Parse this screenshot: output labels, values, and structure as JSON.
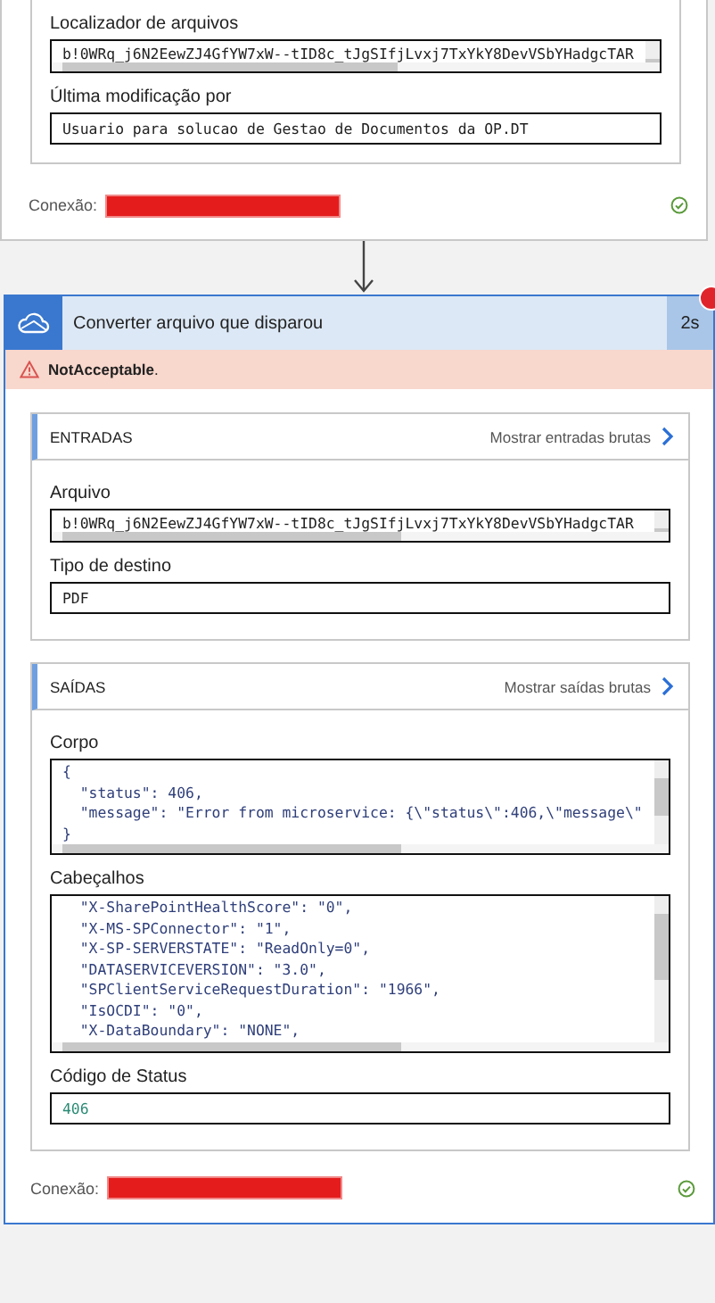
{
  "trigger_card": {
    "fields": [
      {
        "label": "Localizador de arquivos",
        "kind": "scroll-line",
        "lines": [
          "b!0WRq_j6N2EewZJ4GfYW7xW--tID8c_tJgSIfjLvxj7TxYkY8DevVSbYHadgcTAR"
        ]
      },
      {
        "label": "Última modificação por",
        "kind": "line",
        "lines": [
          "Usuario para solucao de Gestao de Documentos da OP.DT"
        ]
      }
    ],
    "connection": {
      "label": "Conexão:",
      "connected": true
    }
  },
  "action_card": {
    "title": "Converter arquivo que disparou",
    "duration": "2s",
    "error": "**NotAcceptable**.",
    "sections": [
      {
        "title": "ENTRADAS",
        "link": "Mostrar entradas brutas",
        "fields": [
          {
            "label": "Arquivo",
            "kind": "scroll-line",
            "lines": [
              "b!0WRq_j6N2EewZJ4GfYW7xW--tID8c_tJgSIfjLvxj7TxYkY8DevVSbYHadgcTAR"
            ]
          },
          {
            "label": "Tipo de destino",
            "kind": "line",
            "lines": [
              "PDF"
            ]
          }
        ]
      },
      {
        "title": "SAÍDAS",
        "link": "Mostrar saídas brutas",
        "fields": [
          {
            "label": "Corpo",
            "kind": "code",
            "lines": [
              "{",
              "  \"status\": 406,",
              "  \"message\": \"Error from microservice: {\\\"status\\\":406,\\\"message\\\"",
              "}"
            ]
          },
          {
            "label": "Cabeçalhos",
            "kind": "code",
            "lines": [
              "  \"X-SharePointHealthScore\": \"0\",",
              "  \"X-MS-SPConnector\": \"1\",",
              "  \"X-SP-SERVERSTATE\": \"ReadOnly=0\",",
              "  \"DATASERVICEVERSION\": \"3.0\",",
              "  \"SPClientServiceRequestDuration\": \"1966\",",
              "  \"IsOCDI\": \"0\",",
              "  \"X-DataBoundary\": \"NONE\","
            ]
          },
          {
            "label": "Código de Status",
            "kind": "number",
            "lines": [
              "406"
            ]
          }
        ]
      }
    ],
    "connection": {
      "label": "Conexão:",
      "connected": true
    }
  }
}
